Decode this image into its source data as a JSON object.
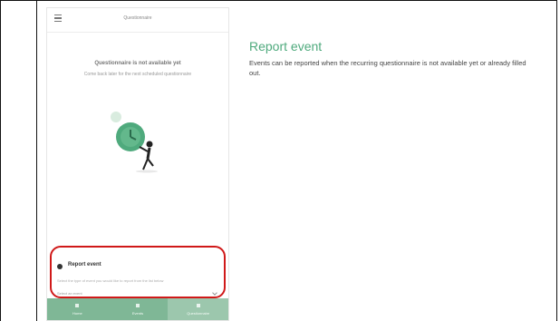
{
  "phone": {
    "header_title": "Questionnaire",
    "empty_title": "Questionnaire is not available yet",
    "empty_subtitle": "Come back later for the next scheduled questionnaire",
    "report_card": {
      "title": "Report event",
      "description": "Select the type of event you would like to report from the list below",
      "select_placeholder": "Select an event"
    },
    "nav": [
      {
        "label": "Home",
        "icon": "home-icon"
      },
      {
        "label": "Events",
        "icon": "calendar-icon"
      },
      {
        "label": "Questionnaire",
        "icon": "clipboard-icon"
      }
    ]
  },
  "detail": {
    "title": "Report event",
    "description": "Events can be reported when the recurring questionnaire is not available yet or already filled out."
  },
  "colors": {
    "accent": "#4faa7d",
    "nav_bg": "#7fb796",
    "highlight": "#d01919"
  }
}
